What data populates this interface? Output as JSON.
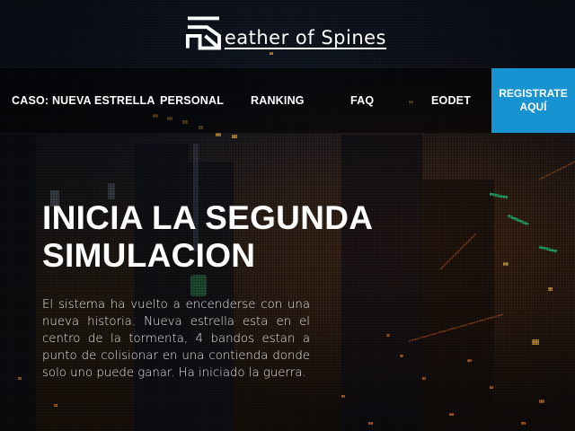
{
  "brand": {
    "logo_text": "eather of Spines"
  },
  "nav": {
    "items": [
      {
        "label": "CASO: NUEVA ESTRELLA"
      },
      {
        "label": "PERSONAL"
      },
      {
        "label": "RANKING"
      },
      {
        "label": "FAQ"
      },
      {
        "label": "EODET"
      }
    ],
    "cta_line1": "REGISTRATE",
    "cta_line2": "AQUÍ"
  },
  "hero": {
    "title_line1": "INICIA LA SEGUNDA",
    "title_line2": "SIMULACION",
    "body": "El sistema ha vuelto a encenderse con una nueva historia. Nueva estrella esta en el centro de la tormenta, 4 bandos estan a punto de colisionar en una contienda donde solo uno puede ganar. Ha iniciado la guerra."
  },
  "colors": {
    "accent": "#1793d1",
    "nav_bg": "#000000",
    "text": "#ffffff"
  }
}
